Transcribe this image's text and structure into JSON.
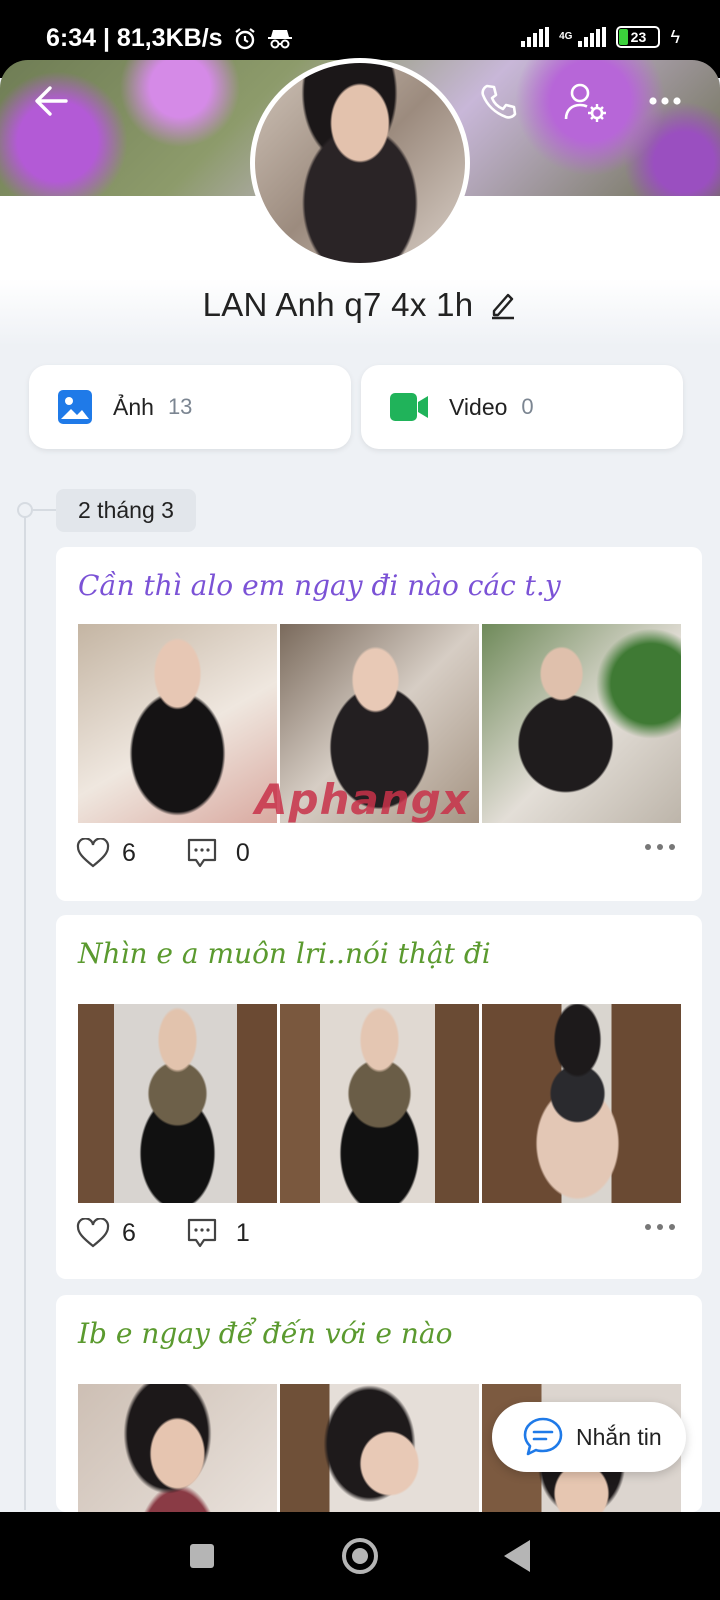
{
  "status_bar": {
    "time_speed": "6:34 | 81,3KB/s",
    "network": "4G",
    "battery": "23"
  },
  "profile": {
    "name": "LAN Anh q7 4x 1h"
  },
  "media_tiles": [
    {
      "label": "Ảnh",
      "count": "13",
      "icon": "image-icon",
      "color": "#1f7ae8"
    },
    {
      "label": "Video",
      "count": "0",
      "icon": "video-icon",
      "color": "#20b35a"
    }
  ],
  "timeline": {
    "date": "2 tháng 3"
  },
  "posts": [
    {
      "title": "Cần thì alo em ngay đi nào các t.y",
      "title_color": "#7b52d6",
      "likes": "6",
      "comments": "0"
    },
    {
      "title": "Nhìn e a muôn lri..nói thật đi",
      "title_color": "#5b9a2f",
      "likes": "6",
      "comments": "1"
    },
    {
      "title": "Ib e ngay để đến với e nào",
      "title_color": "#5b9a2f"
    }
  ],
  "watermark": "Aphangx",
  "message_button": {
    "label": "Nhắn tin",
    "icon": "chat-icon"
  },
  "colors": {
    "accent_blue": "#1f7ae8",
    "accent_green": "#20b35a",
    "background": "#eef1f5"
  }
}
